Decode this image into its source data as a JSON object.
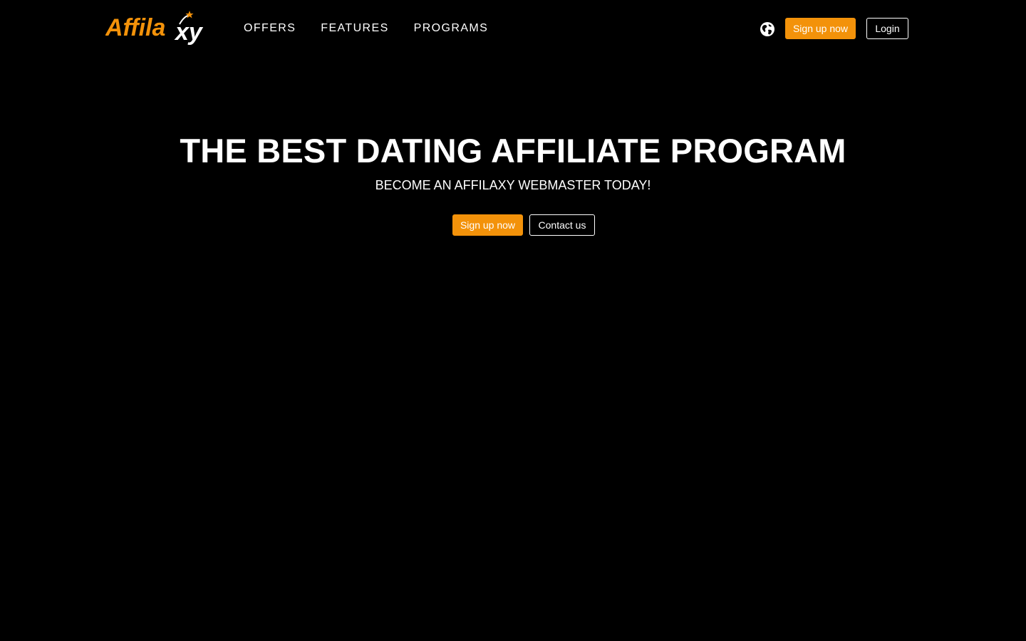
{
  "brand": {
    "logo_text_prefix": "Affila",
    "logo_text_suffix": "xy",
    "accent_color": "#f3920a",
    "background_color": "#000000"
  },
  "nav": {
    "items": [
      {
        "label": "OFFERS"
      },
      {
        "label": "FEATURES"
      },
      {
        "label": "PROGRAMS"
      }
    ]
  },
  "header": {
    "language_icon": "globe-icon",
    "signup_label": "Sign up now",
    "login_label": "Login"
  },
  "hero": {
    "title": "THE BEST DATING AFFILIATE PROGRAM",
    "subtitle": "BECOME AN AFFILAXY WEBMASTER TODAY!",
    "signup_label": "Sign up now",
    "contact_label": "Contact us"
  }
}
